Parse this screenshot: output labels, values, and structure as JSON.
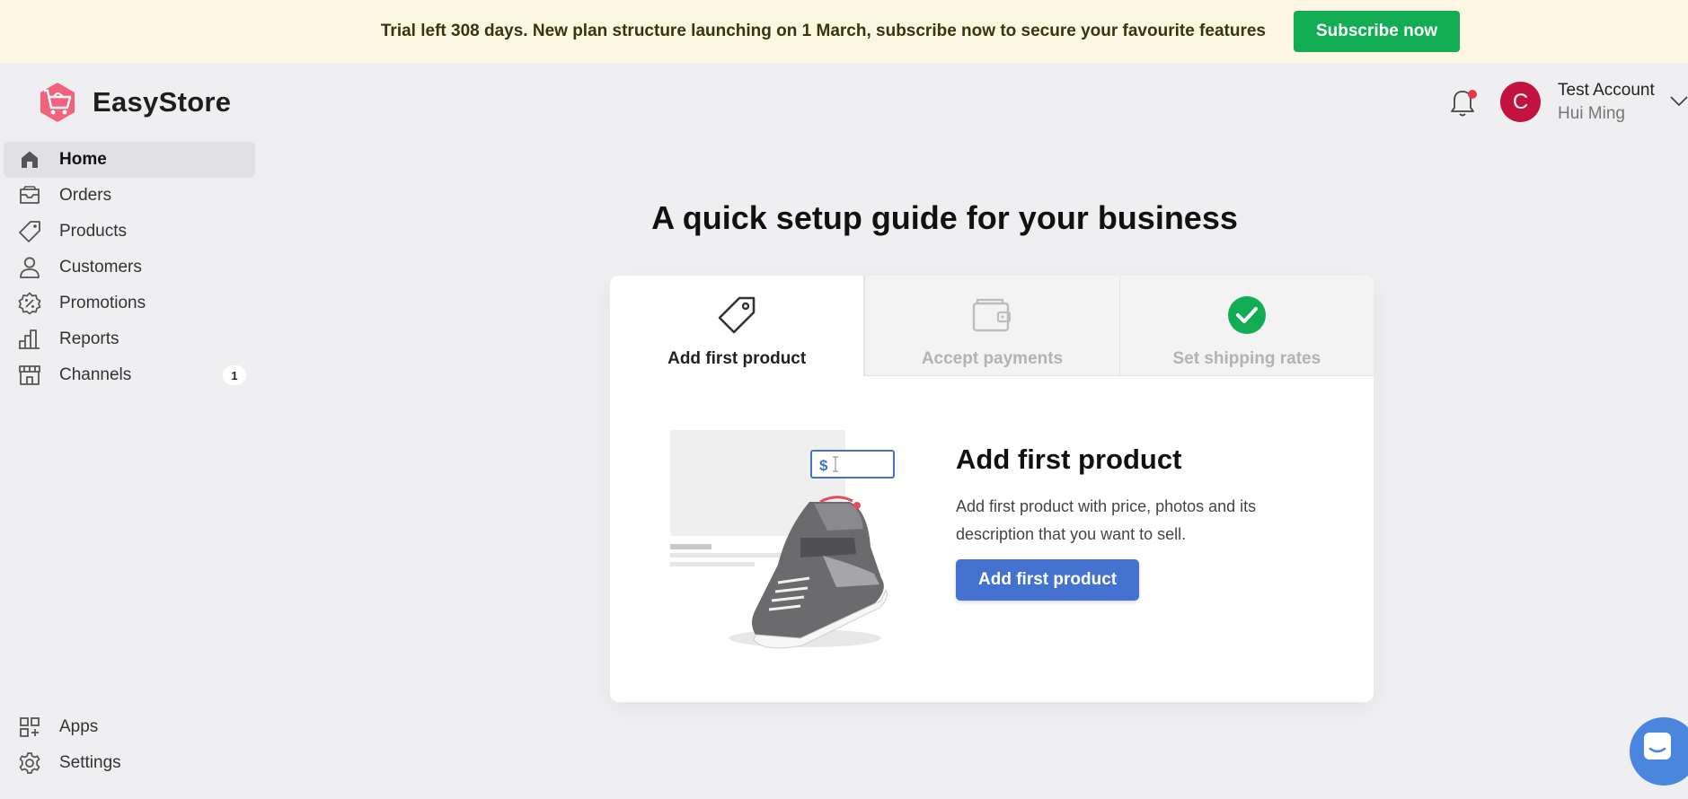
{
  "banner": {
    "text": "Trial left 308 days. New plan structure launching on 1 March, subscribe now to secure your favourite features",
    "button_label": "Subscribe now"
  },
  "brand": {
    "name": "EasyStore",
    "logo_icon": "shopping-cart-logo-icon"
  },
  "sidebar": {
    "items": [
      {
        "label": "Home",
        "icon": "home-icon",
        "active": true
      },
      {
        "label": "Orders",
        "icon": "inbox-icon"
      },
      {
        "label": "Products",
        "icon": "tag-icon"
      },
      {
        "label": "Customers",
        "icon": "user-icon"
      },
      {
        "label": "Promotions",
        "icon": "discount-badge-icon"
      },
      {
        "label": "Reports",
        "icon": "bar-chart-icon"
      },
      {
        "label": "Channels",
        "icon": "storefront-icon",
        "badge": "1"
      }
    ],
    "bottom_items": [
      {
        "label": "Apps",
        "icon": "apps-grid-icon"
      },
      {
        "label": "Settings",
        "icon": "gear-icon"
      }
    ]
  },
  "header": {
    "avatar_initial": "C",
    "account_name": "Test Account",
    "user_name": "Hui Ming",
    "notification_dot": true
  },
  "guide": {
    "title": "A quick setup guide for your business",
    "tabs": [
      {
        "label": "Add first product",
        "icon": "price-tag-icon",
        "active": true
      },
      {
        "label": "Accept payments",
        "icon": "wallet-icon"
      },
      {
        "label": "Set shipping rates",
        "icon": "check-circle-icon",
        "completed": true
      }
    ],
    "step": {
      "title": "Add first product",
      "description": "Add first product with price, photos and its description that you want to sell.",
      "button_label": "Add first product",
      "price_symbol": "$"
    }
  },
  "colors": {
    "banner_bg": "#fcf6e2",
    "subscribe": "#12ad52",
    "primary": "#4472d0",
    "avatar": "#c4123f",
    "check": "#12ad52",
    "chat": "#4a86de"
  }
}
